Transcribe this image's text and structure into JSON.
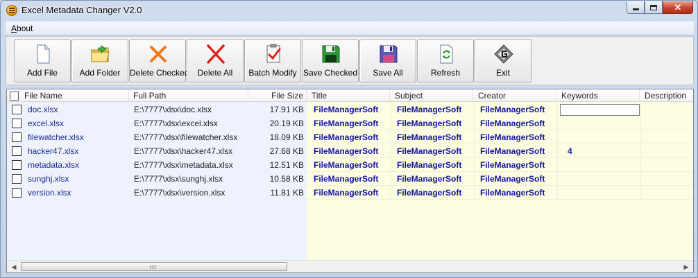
{
  "window": {
    "title": "Excel Metadata Changer V2.0",
    "close_glyph": "✕"
  },
  "menu": {
    "about": "About"
  },
  "toolbar": {
    "buttons": [
      {
        "label": "Add File",
        "icon": "file-icon"
      },
      {
        "label": "Add Folder",
        "icon": "folder-add-icon"
      },
      {
        "label": "Delete Checked",
        "icon": "delete-checked-icon"
      },
      {
        "label": "Delete All",
        "icon": "delete-all-icon"
      },
      {
        "label": "Batch Modify",
        "icon": "batch-modify-icon"
      },
      {
        "label": "Save Checked",
        "icon": "save-checked-icon"
      },
      {
        "label": "Save All",
        "icon": "save-all-icon"
      },
      {
        "label": "Refresh",
        "icon": "refresh-icon"
      },
      {
        "label": "Exit",
        "icon": "exit-icon"
      }
    ]
  },
  "table": {
    "columns": {
      "file_name": "File Name",
      "full_path": "Full Path",
      "file_size": "File Size",
      "title": "Title",
      "subject": "Subject",
      "creator": "Creator",
      "keywords": "Keywords",
      "description": "Description"
    },
    "rows": [
      {
        "name": "doc.xlsx",
        "path": "E:\\7777\\xlsx\\doc.xlsx",
        "size": "17.91 KB",
        "title": "FileManagerSoft",
        "subject": "FileManagerSoft",
        "creator": "FileManagerSoft",
        "keywords": ""
      },
      {
        "name": "excel.xlsx",
        "path": "E:\\7777\\xlsx\\excel.xlsx",
        "size": "20.19 KB",
        "title": "FileManagerSoft",
        "subject": "FileManagerSoft",
        "creator": "FileManagerSoft",
        "keywords": ""
      },
      {
        "name": "filewatcher.xlsx",
        "path": "E:\\7777\\xlsx\\filewatcher.xlsx",
        "size": "18.09 KB",
        "title": "FileManagerSoft",
        "subject": "FileManagerSoft",
        "creator": "FileManagerSoft",
        "keywords": ""
      },
      {
        "name": "hacker47.xlsx",
        "path": "E:\\7777\\xlsx\\hacker47.xlsx",
        "size": "27.68 KB",
        "title": "FileManagerSoft",
        "subject": "FileManagerSoft",
        "creator": "FileManagerSoft",
        "keywords": "4"
      },
      {
        "name": "metadata.xlsx",
        "path": "E:\\7777\\xlsx\\metadata.xlsx",
        "size": "12.51 KB",
        "title": "FileManagerSoft",
        "subject": "FileManagerSoft",
        "creator": "FileManagerSoft",
        "keywords": ""
      },
      {
        "name": "sunghj.xlsx",
        "path": "E:\\7777\\xlsx\\sunghj.xlsx",
        "size": "10.58 KB",
        "title": "FileManagerSoft",
        "subject": "FileManagerSoft",
        "creator": "FileManagerSoft",
        "keywords": ""
      },
      {
        "name": "version.xlsx",
        "path": "E:\\7777\\xlsx\\version.xlsx",
        "size": "11.81 KB",
        "title": "FileManagerSoft",
        "subject": "FileManagerSoft",
        "creator": "FileManagerSoft",
        "keywords": ""
      }
    ]
  },
  "scrollbar": {
    "left_arrow": "◀",
    "right_arrow": "▶"
  },
  "colors": {
    "left_zone_bg": "#eef2fd",
    "right_zone_bg": "#fdfde2",
    "metadata_text": "#1414a0",
    "filename_text": "#1a2a9a"
  }
}
